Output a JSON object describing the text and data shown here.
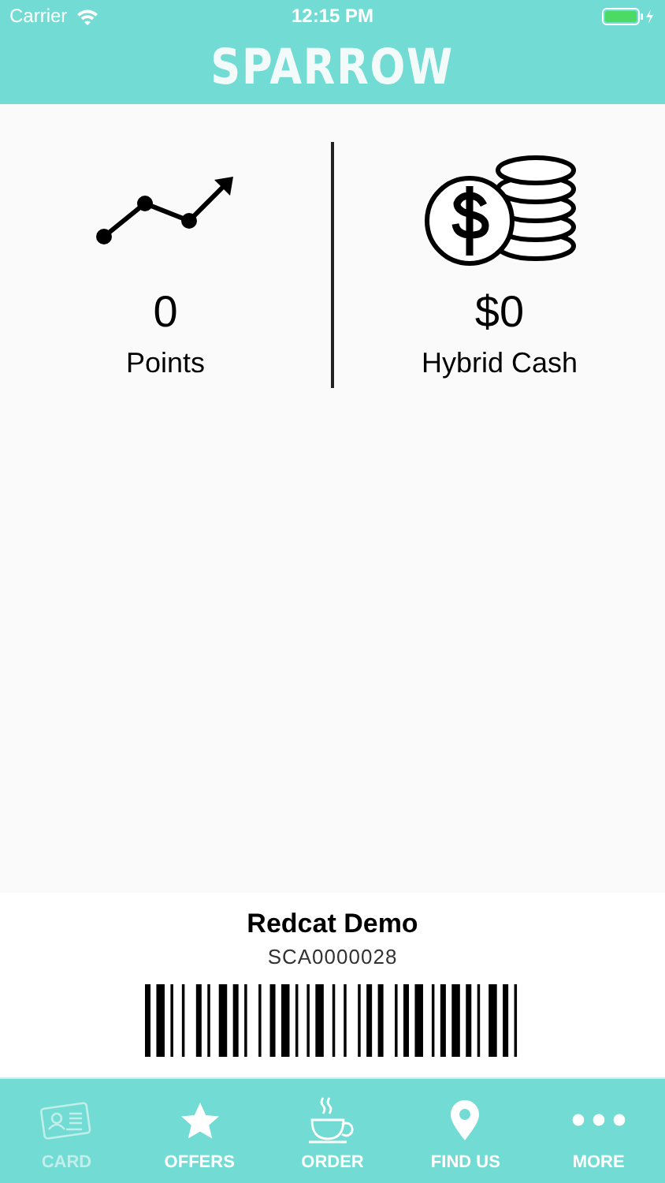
{
  "status_bar": {
    "carrier": "Carrier",
    "time": "12:15 PM"
  },
  "header": {
    "title": "SPARROW"
  },
  "stats": [
    {
      "value": "0",
      "label": "Points"
    },
    {
      "value": "$0",
      "label": "Hybrid Cash"
    }
  ],
  "card": {
    "name": "Redcat Demo",
    "number": "SCA0000028"
  },
  "tabs": [
    {
      "label": "CARD",
      "selected": true
    },
    {
      "label": "OFFERS",
      "selected": false
    },
    {
      "label": "ORDER",
      "selected": false
    },
    {
      "label": "FIND US",
      "selected": false
    },
    {
      "label": "MORE",
      "selected": false
    }
  ]
}
